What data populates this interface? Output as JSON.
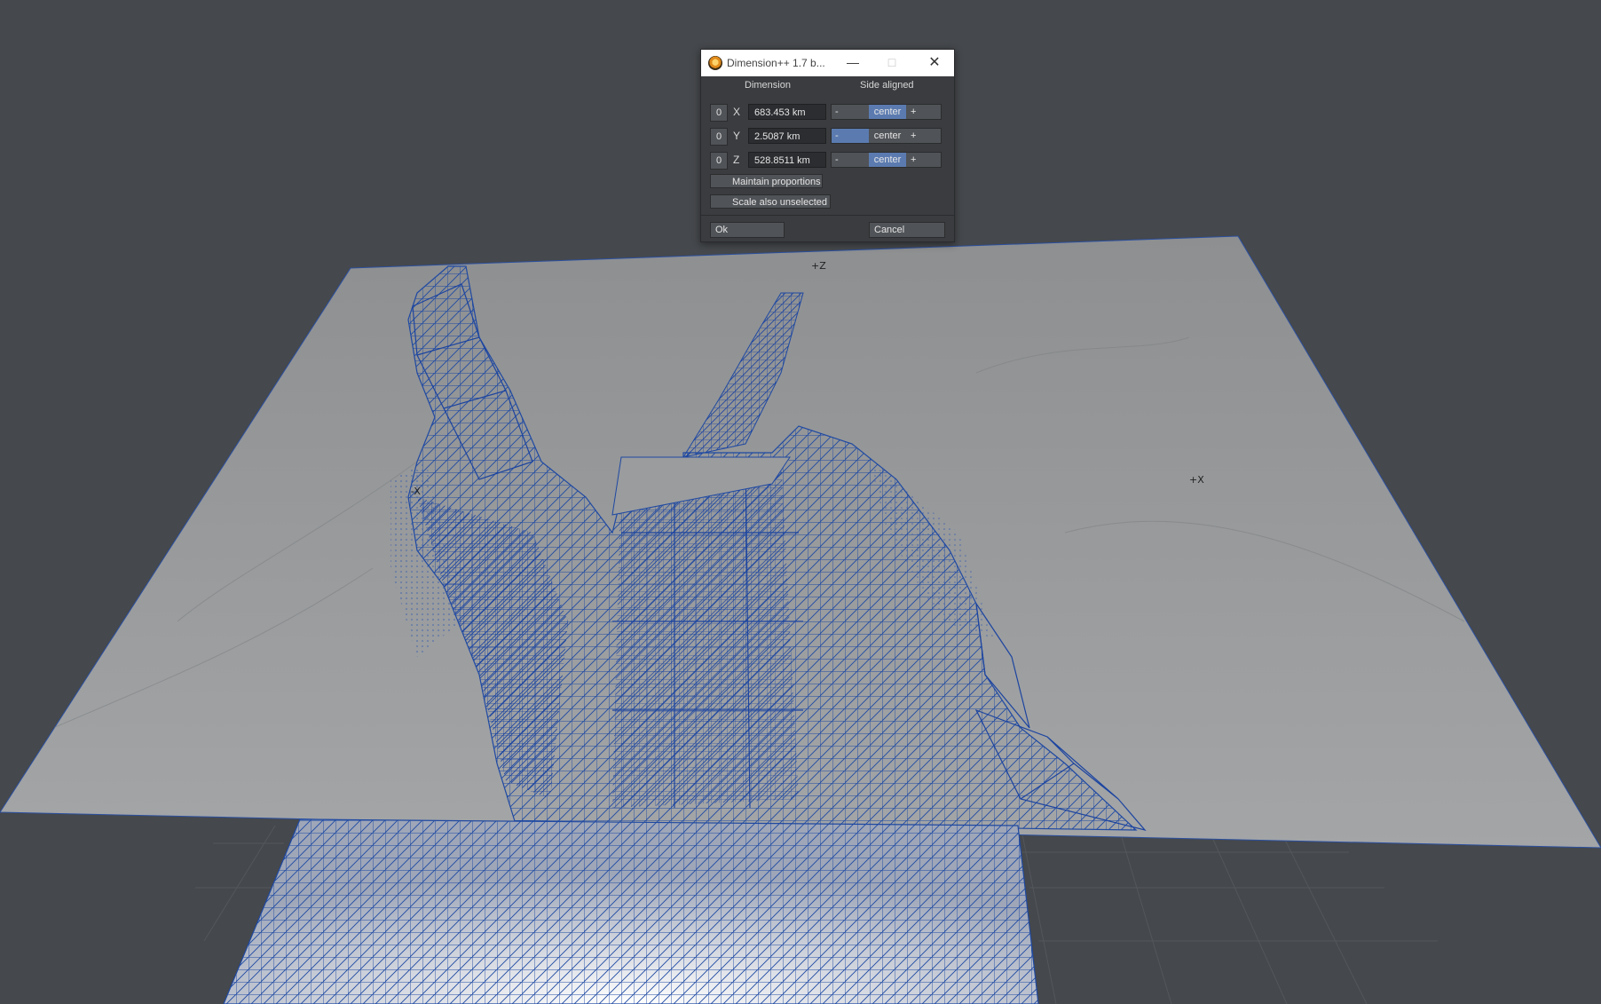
{
  "viewport": {
    "axis_labels": {
      "pos_z": "+Z",
      "neg_x": "-X",
      "pos_x": "+X"
    }
  },
  "dialog": {
    "title": "Dimension++ 1.7  b...",
    "icons": {
      "app": "lightwave-icon",
      "minimize": "minimize-icon",
      "maximize": "maximize-icon",
      "close": "close-icon"
    },
    "headers": {
      "dimension": "Dimension",
      "side_aligned": "Side aligned"
    },
    "rows": [
      {
        "reset": "0",
        "axis": "X",
        "value": "683.453 km",
        "minus": "-",
        "center": "center",
        "plus": "+",
        "active": "center"
      },
      {
        "reset": "0",
        "axis": "Y",
        "value": "2.5087 km",
        "minus": "-",
        "center": "center",
        "plus": "+",
        "active": "minus"
      },
      {
        "reset": "0",
        "axis": "Z",
        "value": "528.8511 km",
        "minus": "-",
        "center": "center",
        "plus": "+",
        "active": "center"
      }
    ],
    "maintain_proportions": "Maintain proportions",
    "scale_also_unselected": "Scale also unselected",
    "ok": "Ok",
    "cancel": "Cancel",
    "accent_color": "#5b7bb0"
  }
}
